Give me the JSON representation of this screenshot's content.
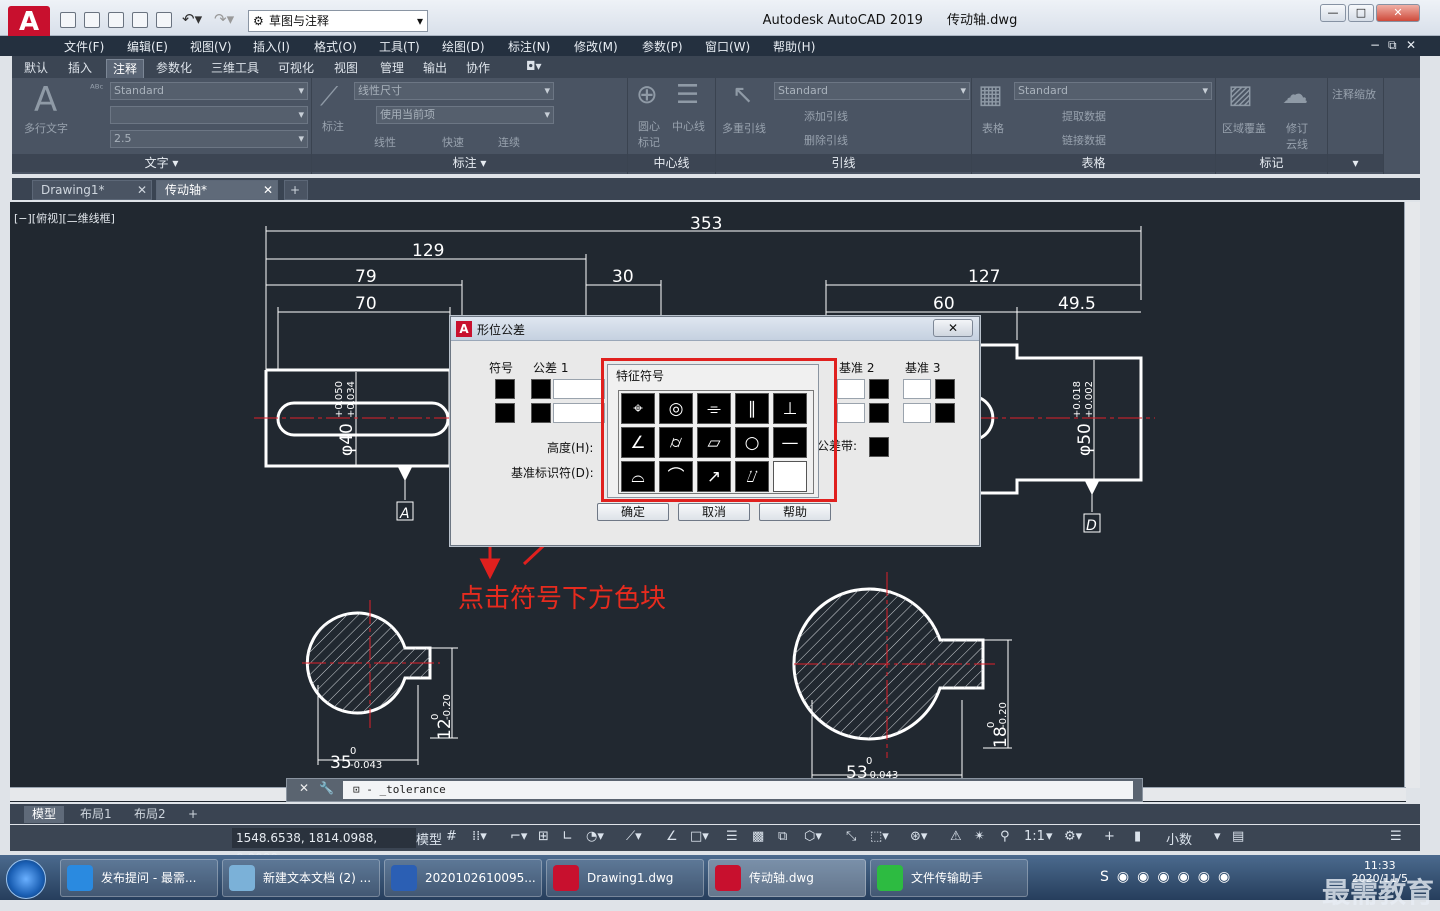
{
  "app": {
    "title": "Autodesk AutoCAD 2019",
    "filename": "传动轴.dwg",
    "workspace": "草图与注释"
  },
  "menu": [
    "文件(F)",
    "编辑(E)",
    "视图(V)",
    "插入(I)",
    "格式(O)",
    "工具(T)",
    "绘图(D)",
    "标注(N)",
    "修改(M)",
    "参数(P)",
    "窗口(W)",
    "帮助(H)"
  ],
  "ribbon_tabs": [
    "默认",
    "插入",
    "注释",
    "参数化",
    "三维工具",
    "可视化",
    "视图",
    "管理",
    "输出",
    "协作"
  ],
  "ribbon_active": "注释",
  "ribbon": {
    "text_panel": {
      "title": "文字 ▾",
      "big_label": "多行文字",
      "style": "Standard",
      "height": "2.5"
    },
    "dim_panel": {
      "title": "标注 ▾",
      "big_label": "标注",
      "style": "线性尺寸",
      "layer": "使用当前项",
      "b1": "线性",
      "b2": "快速",
      "b3": "连续"
    },
    "center_panel": {
      "title": "中心线",
      "l1": "圆心标记",
      "l2": "中心线"
    },
    "leader_panel": {
      "title": "引线",
      "big_label": "多重引线",
      "style": "Standard",
      "l1": "添加引线",
      "l2": "删除引线"
    },
    "table_panel": {
      "title": "表格",
      "big_label": "表格",
      "style": "Standard",
      "l1": "提取数据",
      "l2": "链接数据"
    },
    "mark_panel": {
      "title": "标记",
      "l1": "区域覆盖",
      "l2": "修订云线"
    },
    "scale_panel": {
      "l1": "注释缩放"
    }
  },
  "doc_tabs": [
    "Drawing1*",
    "传动轴*"
  ],
  "active_doc": "传动轴*",
  "view_label": "[−][俯视][二维线框]",
  "drawing": {
    "dims": [
      "353",
      "129",
      "79",
      "70",
      "30",
      "127",
      "60",
      "49.5"
    ],
    "tol1": {
      "base": "φ40",
      "up": "+0.050",
      "low": "+0.034"
    },
    "tol2": {
      "base": "φ50",
      "up": "+0.018",
      "low": "+0.002"
    },
    "datum_a": "A",
    "datum_d": "D",
    "sec1": {
      "d": "35",
      "t": "0",
      "l": "-0.043",
      "w": "12",
      "wt": "0",
      "wl": "-0.20"
    },
    "sec2": {
      "d": "53",
      "t": "0",
      "l": "-0.043",
      "w": "18",
      "wt": "0",
      "wl": "-0.20"
    }
  },
  "dialog": {
    "title": "形位公差",
    "col_symbol": "符号",
    "col_tol1": "公差 1",
    "col_datum2": "基准 2",
    "col_datum3": "基准 3",
    "height_label": "高度(H):",
    "datum_id_label": "基准标识符(D):",
    "tolzone_label": "公差带:",
    "ok": "确定",
    "cancel": "取消",
    "help": "帮助",
    "close": "✕"
  },
  "symbol_popup": {
    "title": "特征符号",
    "symbols": [
      "⌖",
      "◎",
      "⌯",
      "∥",
      "⊥",
      "∠",
      "⌭",
      "▱",
      "○",
      "—",
      "⌓",
      "⌒",
      "↗",
      "⌰",
      ""
    ]
  },
  "annotation": "点击符号下方色块",
  "command": {
    "prefix": "⊡ - ",
    "text": "_tolerance"
  },
  "layout_tabs": [
    "模型",
    "布局1",
    "布局2"
  ],
  "status": {
    "coords": "1548.6538, 1814.0988, 0.0000",
    "model": "模型",
    "scale": "1:1",
    "units": "小数"
  },
  "taskbar": [
    {
      "label": "发布提问 - 最需...",
      "color": "#2a8ae0"
    },
    {
      "label": "新建文本文档 (2) ...",
      "color": "#7bb1d8"
    },
    {
      "label": "2020102610095...",
      "color": "#2b5fb4"
    },
    {
      "label": "Drawing1.dwg",
      "color": "#c8102e"
    },
    {
      "label": "传动轴.dwg",
      "color": "#c8102e"
    },
    {
      "label": "文件传输助手",
      "color": "#2dbb41"
    }
  ],
  "clock": {
    "time": "11:33",
    "date": "2020/11/5"
  },
  "brand": "最需教育",
  "colors": {
    "accent_red": "#e0201e",
    "canvas": "#212830",
    "autocad_red": "#c8102e"
  }
}
